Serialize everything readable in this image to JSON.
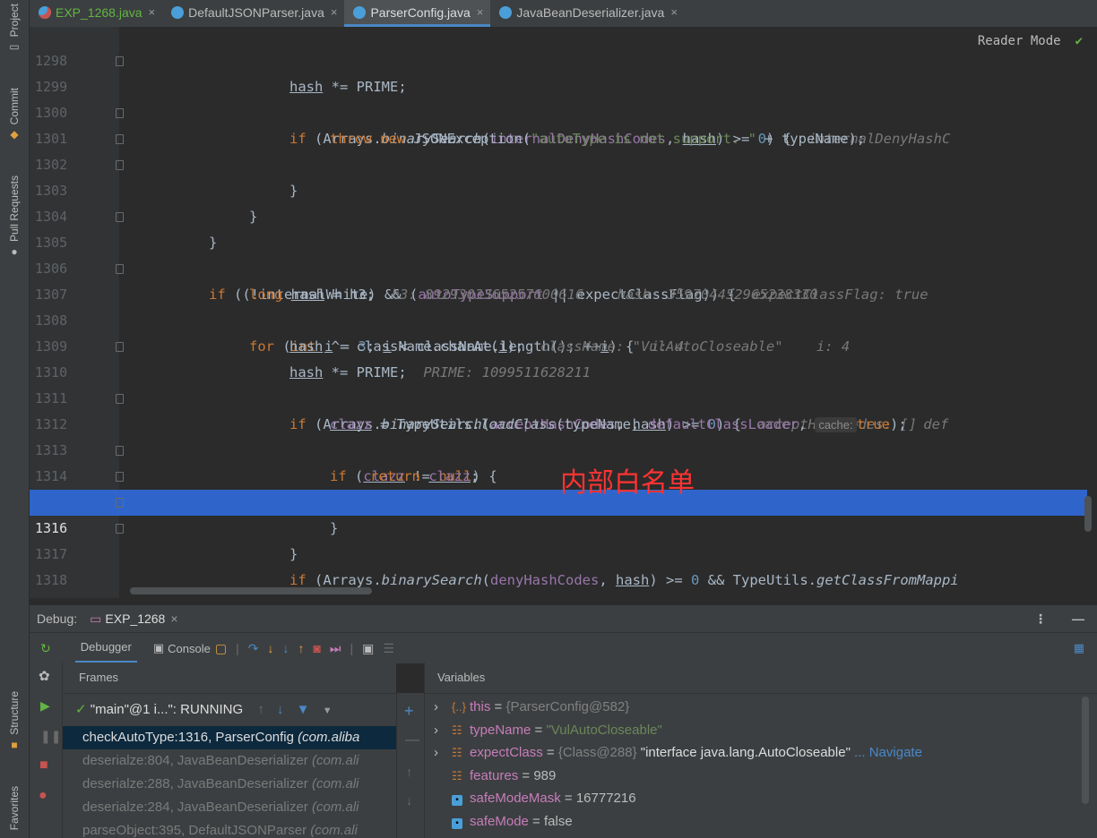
{
  "side_tabs": {
    "project": "Project",
    "commit": "Commit",
    "pull_requests": "Pull Requests",
    "structure": "Structure",
    "favorites": "Favorites"
  },
  "tabs": [
    {
      "label": "EXP_1268.java"
    },
    {
      "label": "DefaultJSONParser.java"
    },
    {
      "label": "ParserConfig.java"
    },
    {
      "label": "JavaBeanDeserializer.java"
    }
  ],
  "editor": {
    "reader_mode": "Reader Mode",
    "annotation": "内部白名单",
    "lines": [
      "1298",
      "1299",
      "1300",
      "1301",
      "1302",
      "1303",
      "1304",
      "1305",
      "1306",
      "1307",
      "1308",
      "1309",
      "1310",
      "1311",
      "1312",
      "1313",
      "1314",
      "1315",
      "1316",
      "1317",
      "1318"
    ],
    "hints": {
      "h1299": "internalDenyHashC",
      "h1305": "expectClassFlag: true",
      "h1306a": "h3: 8929303365257600616",
      "h1306b": "hash: 359704452965238330",
      "h1307": "i: 4",
      "h1308a": "className: \"VulAutoCloseable\"",
      "h1308b": "i: 4",
      "h1309": "PRIME: 1099511628211",
      "h1310": "acceptHashCodes: []",
      "h1311_inlay": "cache:",
      "h1311": "def"
    }
  },
  "debug": {
    "label": "Debug:",
    "session": "EXP_1268",
    "debugger_tab": "Debugger",
    "console_tab": "Console",
    "frames_title": "Frames",
    "variables_title": "Variables",
    "thread": "\"main\"@1 i...\": RUNNING",
    "frames": [
      {
        "method": "checkAutoType:1316, ParserConfig",
        "pkg": "(com.aliba"
      },
      {
        "method": "deserialze:804, JavaBeanDeserializer",
        "pkg": "(com.ali"
      },
      {
        "method": "deserialze:288, JavaBeanDeserializer",
        "pkg": "(com.ali"
      },
      {
        "method": "deserialze:284, JavaBeanDeserializer",
        "pkg": "(com.ali"
      },
      {
        "method": "parseObject:395, DefaultJSONParser",
        "pkg": "(com.ali"
      }
    ],
    "variables": [
      {
        "icon": "{..}",
        "name": "this",
        "eq": " = ",
        "value": "{ParserConfig@582}",
        "extra": "",
        "nav": ""
      },
      {
        "icon": "☷",
        "name": "typeName",
        "eq": " = ",
        "value": "\"VulAutoCloseable\"",
        "extra": "",
        "nav": ""
      },
      {
        "icon": "☷",
        "name": "expectClass",
        "eq": " = ",
        "value": "{Class@288}",
        "extra": " \"interface java.lang.AutoCloseable\"",
        "nav": " ... Navigate"
      },
      {
        "icon": "☷",
        "name": "features",
        "eq": " = ",
        "value": "989",
        "extra": "",
        "nav": ""
      },
      {
        "icon": "▪",
        "name": "safeModeMask",
        "eq": " = ",
        "value": "16777216",
        "extra": "",
        "nav": ""
      },
      {
        "icon": "▪",
        "name": "safeMode",
        "eq": " = ",
        "value": "false",
        "extra": "",
        "nav": ""
      }
    ]
  }
}
